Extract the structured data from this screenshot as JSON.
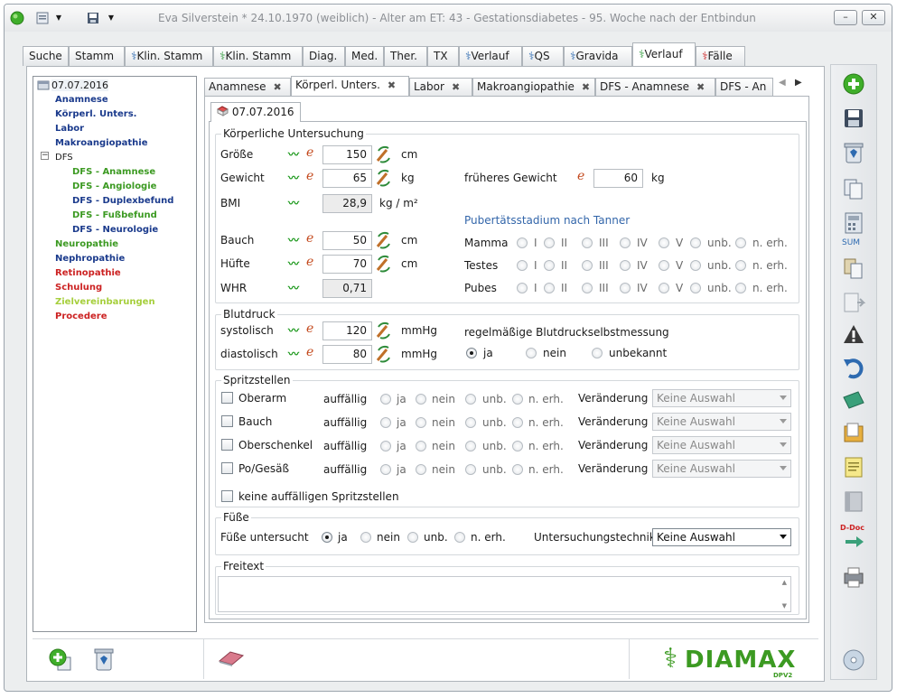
{
  "window": {
    "title": "Eva Silverstein  * 24.10.1970 (weiblich) - Alter am ET: 43 - Gestationsdiabetes - 95. Woche nach der Entbindung",
    "minimize_label": "–",
    "close_label": "✕"
  },
  "main_tabs": [
    "Suche",
    "Stamm",
    "Klin. Stamm",
    "Klin. Stamm",
    "Diag.",
    "Med.",
    "Ther.",
    "TX",
    "Verlauf",
    "QS",
    "Gravida",
    "Verlauf",
    "Fälle"
  ],
  "tree": {
    "root_date": "07.07.2016",
    "items": [
      {
        "label": "Anamnese",
        "color": "#1a3a8c"
      },
      {
        "label": "Körperl. Unters.",
        "color": "#1a3a8c"
      },
      {
        "label": "Labor",
        "color": "#1a3a8c"
      },
      {
        "label": "Makroangiopathie",
        "color": "#1a3a8c"
      },
      {
        "label": "DFS",
        "color": "#1a1a1a"
      },
      {
        "label": "DFS - Anamnese",
        "color": "#3c9a22"
      },
      {
        "label": "DFS - Angiologie",
        "color": "#3c9a22"
      },
      {
        "label": "DFS - Duplexbefund",
        "color": "#1a3a8c"
      },
      {
        "label": "DFS - Fußbefund",
        "color": "#3c9a22"
      },
      {
        "label": "DFS - Neurologie",
        "color": "#1a3a8c"
      },
      {
        "label": "Neuropathie",
        "color": "#3c9a22"
      },
      {
        "label": "Nephropathie",
        "color": "#1a3a8c"
      },
      {
        "label": "Retinopathie",
        "color": "#cc2222"
      },
      {
        "label": "Schulung",
        "color": "#cc2222"
      },
      {
        "label": "Zielvereinbarungen",
        "color": "#a6cf3c"
      },
      {
        "label": "Procedere",
        "color": "#cc2222"
      }
    ]
  },
  "sub_tabs": [
    "Anamnese",
    "Körperl. Unters.",
    "Labor",
    "Makroangiopathie",
    "DFS - Anamnese",
    "DFS - An"
  ],
  "date_tab": "07.07.2016",
  "koerperliche": {
    "title": "Körperliche Untersuchung",
    "groesse": {
      "label": "Größe",
      "value": "150",
      "unit": "cm"
    },
    "gewicht": {
      "label": "Gewicht",
      "value": "65",
      "unit": "kg"
    },
    "frueheres": {
      "label": "früheres Gewicht",
      "value": "60",
      "unit": "kg"
    },
    "bmi": {
      "label": "BMI",
      "value": "28,9",
      "unit": "kg / m²"
    },
    "bauch": {
      "label": "Bauch",
      "value": "50",
      "unit": "cm"
    },
    "huefte": {
      "label": "Hüfte",
      "value": "70",
      "unit": "cm"
    },
    "whr": {
      "label": "WHR",
      "value": "0,71"
    },
    "tanner_title": "Pubertätsstadium nach Tanner",
    "tanner_rows": [
      "Mamma",
      "Testes",
      "Pubes"
    ],
    "tanner_options": [
      "I",
      "II",
      "III",
      "IV",
      "V",
      "unb.",
      "n. erh."
    ]
  },
  "blutdruck": {
    "title": "Blutdruck",
    "systolisch": {
      "label": "systolisch",
      "value": "120",
      "unit": "mmHg"
    },
    "diastolisch": {
      "label": "diastolisch",
      "value": "80",
      "unit": "mmHg"
    },
    "selbst_label": "regelmäßige Blutdruckselbstmessung",
    "options": [
      "ja",
      "nein",
      "unbekannt"
    ],
    "selected": "ja"
  },
  "spritzstellen": {
    "title": "Spritzstellen",
    "auffaellig": "auffällig",
    "options": [
      "ja",
      "nein",
      "unb.",
      "n. erh."
    ],
    "veraenderung": "Veränderung",
    "select_value": "Keine Auswahl",
    "sites": [
      "Oberarm",
      "Bauch",
      "Oberschenkel",
      "Po/Gesäß"
    ],
    "none_label": "keine auffälligen Spritzstellen"
  },
  "fuesse": {
    "title": "Füße",
    "label": "Füße untersucht",
    "options": [
      "ja",
      "nein",
      "unb.",
      "n. erh."
    ],
    "selected": "ja",
    "technik_label": "Untersuchungstechnik",
    "technik_value": "Keine Auswahl"
  },
  "freitext": {
    "title": "Freitext"
  },
  "sidebar_sum_label": "SUM",
  "sidebar_ddoc_label": "D-Doc",
  "logo": {
    "text": "DIAMAX",
    "sub": "DPV2"
  },
  "colors": {
    "accent_green": "#3c9a22",
    "link_blue": "#3366aa",
    "active_tab_green": "#2e8b57"
  }
}
